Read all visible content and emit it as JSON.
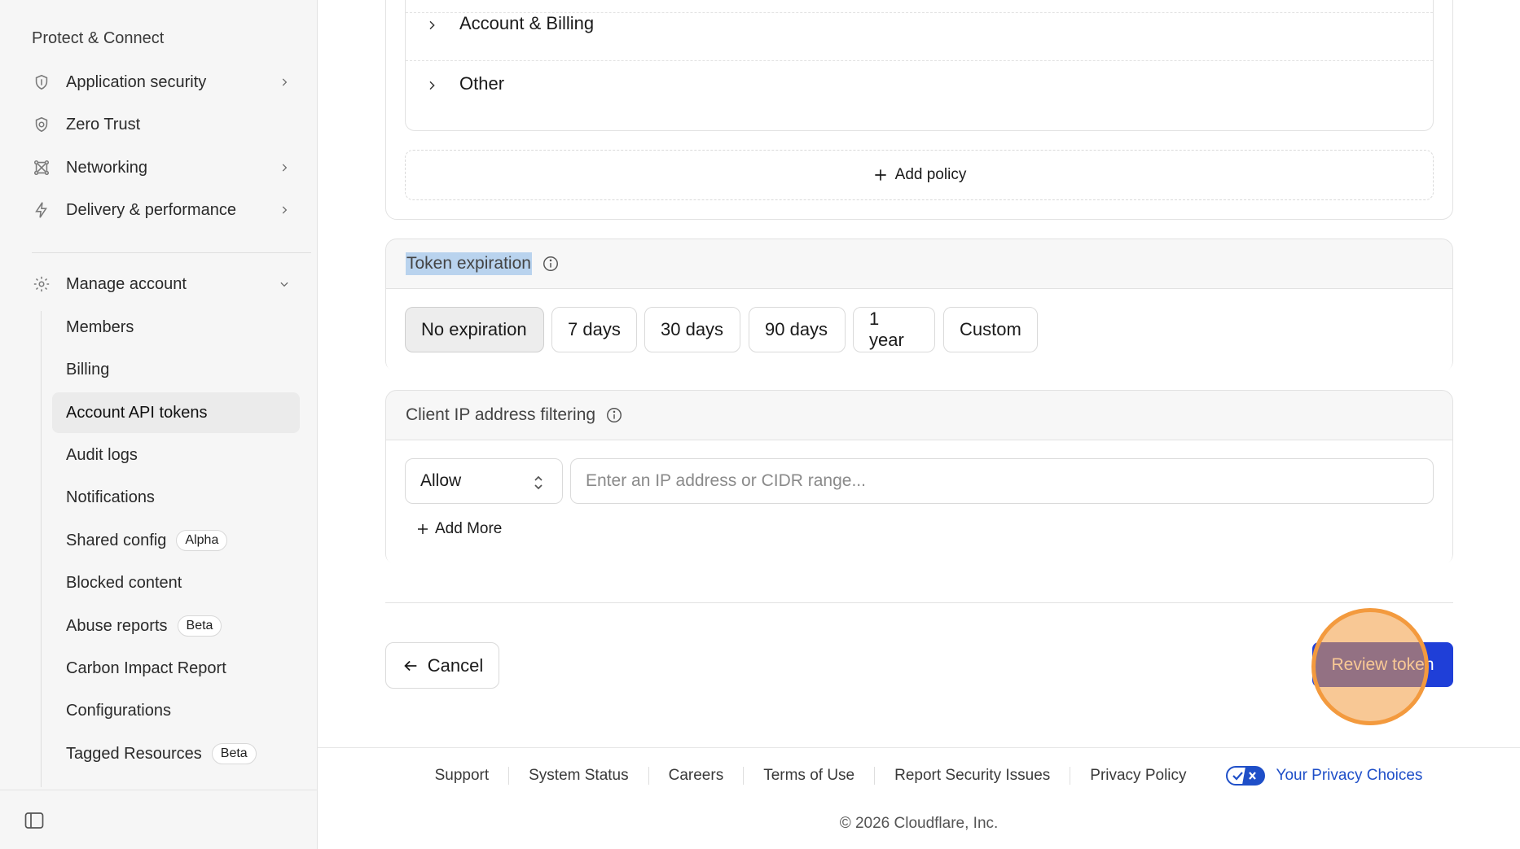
{
  "sidebar": {
    "section_heading": "Protect & Connect",
    "top_items": [
      {
        "label": "Application security",
        "icon": "shield-icon"
      },
      {
        "label": "Zero Trust",
        "icon": "zero-trust-icon"
      },
      {
        "label": "Networking",
        "icon": "network-icon"
      },
      {
        "label": "Delivery & performance",
        "icon": "lightning-icon"
      }
    ],
    "manage_account": {
      "label": "Manage account",
      "icon": "gear-icon"
    },
    "sub_items": [
      {
        "label": "Members"
      },
      {
        "label": "Billing"
      },
      {
        "label": "Account API tokens"
      },
      {
        "label": "Audit logs"
      },
      {
        "label": "Notifications"
      },
      {
        "label": "Shared config",
        "badge": "Alpha"
      },
      {
        "label": "Blocked content"
      },
      {
        "label": "Abuse reports",
        "badge": "Beta"
      },
      {
        "label": "Carbon Impact Report"
      },
      {
        "label": "Configurations"
      },
      {
        "label": "Tagged Resources",
        "badge": "Beta"
      }
    ]
  },
  "policies": {
    "rows": [
      {
        "label": "Account & Billing"
      },
      {
        "label": "Other"
      }
    ],
    "add_policy_label": "Add policy"
  },
  "token_expiration": {
    "title": "Token expiration",
    "options": [
      "No expiration",
      "7 days",
      "30 days",
      "90 days",
      "1 year",
      "Custom"
    ],
    "selected": "No expiration"
  },
  "ip_filtering": {
    "title": "Client IP address filtering",
    "select_value": "Allow",
    "input_placeholder": "Enter an IP address or CIDR range...",
    "add_more_label": "Add More"
  },
  "actions": {
    "cancel_label": "Cancel",
    "review_label": "Review token"
  },
  "footer": {
    "links": [
      "Support",
      "System Status",
      "Careers",
      "Terms of Use",
      "Report Security Issues",
      "Privacy Policy"
    ],
    "privacy_choices_label": "Your Privacy Choices",
    "copyright": "© 2026 Cloudflare, Inc."
  },
  "colors": {
    "primary_button": "#1f3fd8",
    "click_indicator": "#f39a3e",
    "privacy_link": "#1f4fc8",
    "text_highlight": "#b9d3ee"
  }
}
